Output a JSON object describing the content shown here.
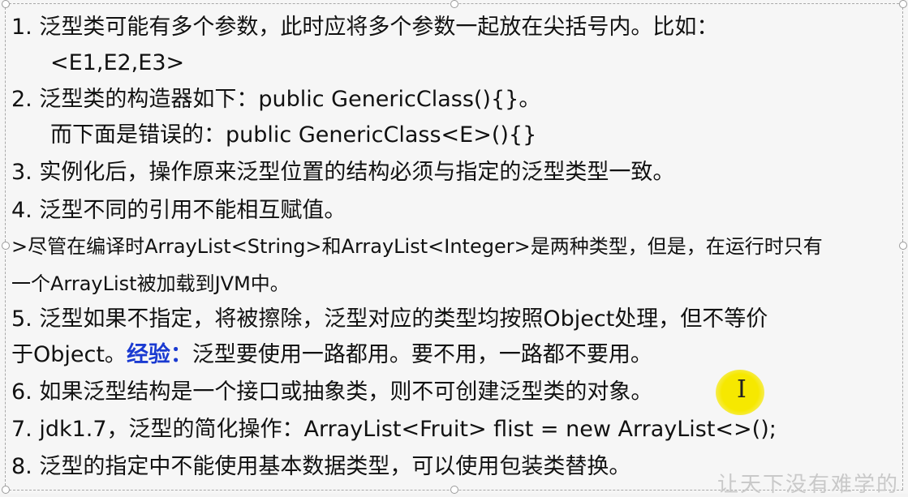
{
  "slide": {
    "lines": [
      {
        "text": "1.  泛型类可能有多个参数，此时应将多个参数一起放在尖括号内。比如："
      },
      {
        "text": "<E1,E2,E3>"
      },
      {
        "text": "2.  泛型类的构造器如下：public GenericClass(){}。"
      },
      {
        "text": "而下面是错误的：public GenericClass<E>(){}"
      },
      {
        "text": "3. 实例化后，操作原来泛型位置的结构必须与指定的泛型类型一致。"
      },
      {
        "text": "4. 泛型不同的引用不能相互赋值。"
      },
      {
        "text": ">尽管在编译时ArrayList<String>和ArrayList<Integer>是两种类型，但是，在运行时只有"
      },
      {
        "text": "一个ArrayList被加载到JVM中。"
      },
      {
        "text": "5. 泛型如果不指定，将被擦除，泛型对应的类型均按照Object处理，但不等价"
      },
      {
        "pre": "于Object。",
        "emph": "经验：",
        "post": "泛型要使用一路都用。要不用，一路都不要用。"
      },
      {
        "text": "6. 如果泛型结构是一个接口或抽象类，则不可创建泛型类的对象。"
      },
      {
        "text": "7. jdk1.7，泛型的简化操作：ArrayList<Fruit> flist = new ArrayList<>();"
      },
      {
        "text": "8. 泛型的指定中不能使用基本数据类型，可以使用包装类替换。"
      }
    ],
    "emph_color": "#1a3ad1",
    "text_color": "#111111",
    "highlight_color": "#f6e800"
  },
  "cursor": {
    "glyph": "I"
  },
  "watermark": {
    "text": "让天下没有难学的"
  }
}
